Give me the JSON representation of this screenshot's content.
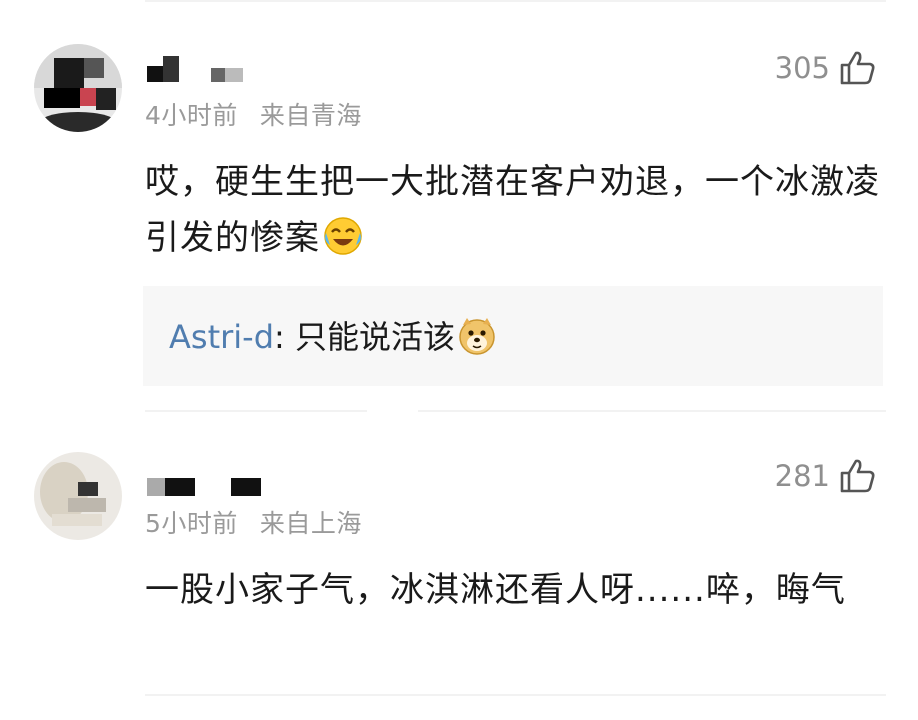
{
  "comments": [
    {
      "time": "4小时前",
      "location": "来自青海",
      "likes": "305",
      "text": "哎，硬生生把一大批潜在客户劝退，一个冰激凌引发的惨案",
      "emoji": "crying-laughing-emoji",
      "reply": {
        "user": "Astri-d",
        "separator": ":",
        "text": "只能说活该",
        "emoji": "doge-emoji"
      }
    },
    {
      "time": "5小时前",
      "location": "来自上海",
      "likes": "281",
      "text": "一股小家子气，冰淇淋还看人呀......啐，晦气"
    }
  ],
  "colors": {
    "reply_user": "#507daf",
    "meta": "#9a9a9a",
    "reply_bg": "#f7f7f7"
  }
}
